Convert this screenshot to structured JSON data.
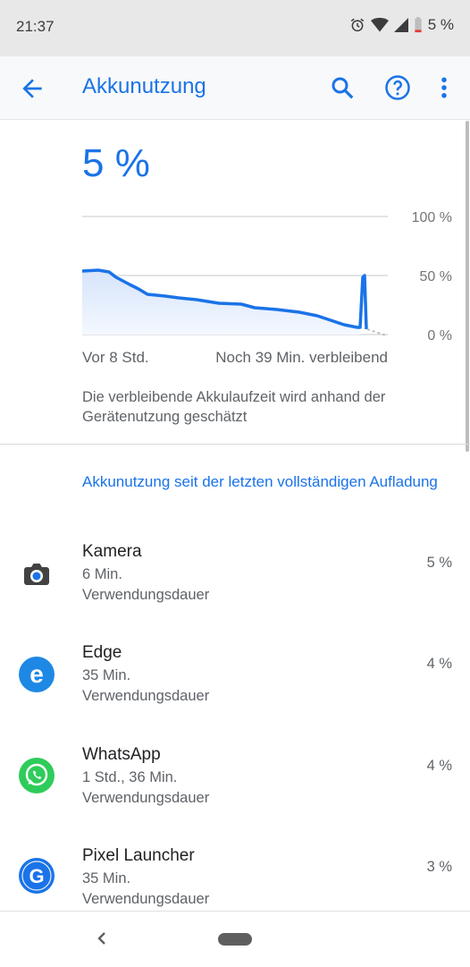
{
  "status_bar": {
    "time": "21:37",
    "battery_text": "5 %"
  },
  "app_bar": {
    "title": "Akkunutzung"
  },
  "battery": {
    "level": "5 %",
    "chart": {
      "y_labels": [
        "100 %",
        "50 %",
        "0 %"
      ],
      "time_left": "Vor 8 Std.",
      "time_right": "Noch 39 Min. verbleibend"
    },
    "estimate_note": "Die verbleibende Akkulaufzeit wird anhand der Gerätenutzung geschätzt"
  },
  "section": {
    "title": "Akkunutzung seit der letzten vollständigen Aufladung"
  },
  "apps": [
    {
      "name": "Kamera",
      "time": "6 Min.",
      "usage_label": "Verwendungsdauer",
      "percent": "5 %",
      "icon": "camera-icon"
    },
    {
      "name": "Edge",
      "time": "35 Min.",
      "usage_label": "Verwendungsdauer",
      "percent": "4 %",
      "icon": "edge-icon"
    },
    {
      "name": "WhatsApp",
      "time": "1 Std., 36 Min.",
      "usage_label": "Verwendungsdauer",
      "percent": "4 %",
      "icon": "whatsapp-icon"
    },
    {
      "name": "Pixel Launcher",
      "time": "35 Min.",
      "usage_label": "Verwendungsdauer",
      "percent": "3 %",
      "icon": "google-icon"
    }
  ],
  "colors": {
    "accent": "#1a73e8",
    "edge": "#1e88e5",
    "whatsapp": "#2ecc5a",
    "google": "#1a73e8"
  }
}
